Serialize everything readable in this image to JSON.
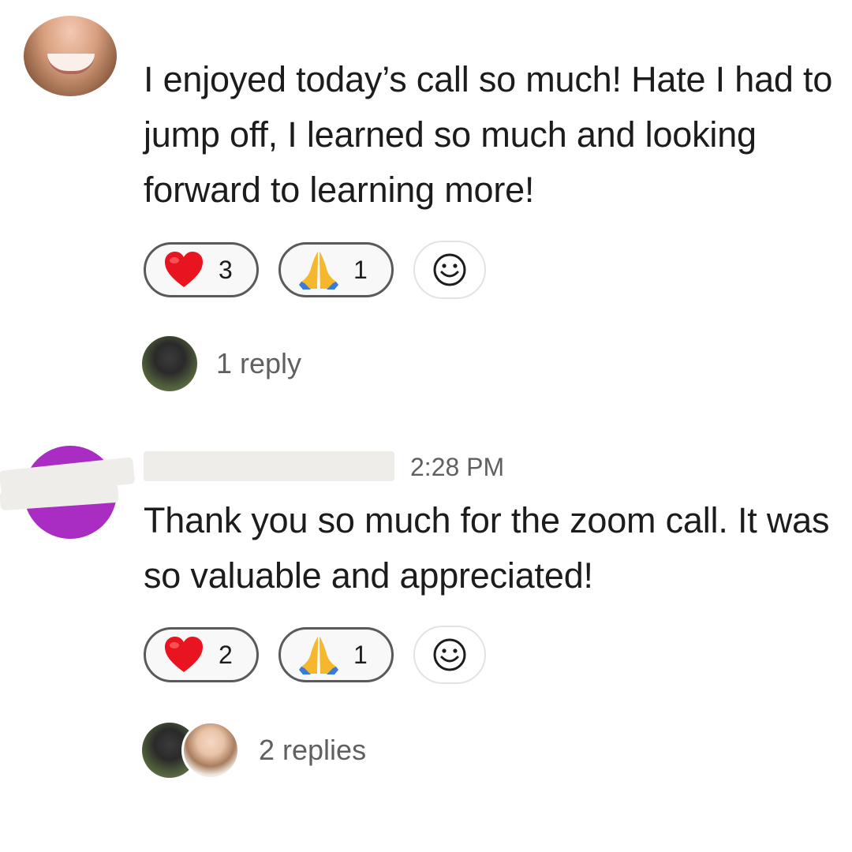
{
  "messages": [
    {
      "text": "I enjoyed today’s call so much! Hate I had to jump off, I learned so much and looking forward to learning more!",
      "reactions": [
        {
          "emoji": "red-heart",
          "count": "3"
        },
        {
          "emoji": "folded-hands",
          "count": "1"
        }
      ],
      "add_reaction_icon": "smiley-face-icon",
      "replies_label": "1 reply"
    },
    {
      "timestamp": "2:28 PM",
      "text": "Thank you so much for the zoom call. It was so valuable and appreciated!",
      "reactions": [
        {
          "emoji": "red-heart",
          "count": "2"
        },
        {
          "emoji": "folded-hands",
          "count": "1"
        }
      ],
      "add_reaction_icon": "smiley-face-icon",
      "replies_label": "2 replies"
    }
  ],
  "colors": {
    "text": "#1d1c1d",
    "muted": "#616061",
    "avatar_purple": "#aa2dc3",
    "reaction_border": "#5a5a5a",
    "redaction": "#eeede9"
  }
}
